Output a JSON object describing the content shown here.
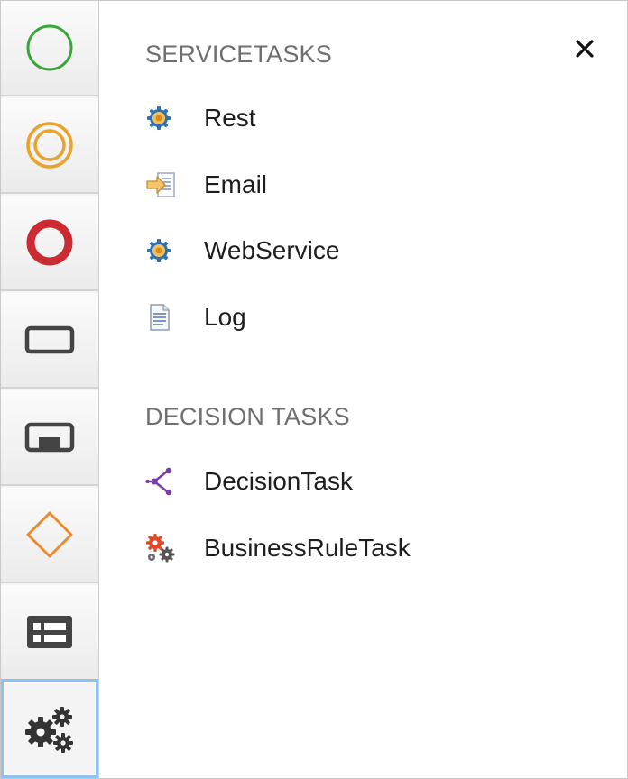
{
  "toolbar": {
    "tools": [
      {
        "icon": "start-event-icon",
        "color": "#3aa63a"
      },
      {
        "icon": "intermediate-event-icon",
        "color": "#e9a22a"
      },
      {
        "icon": "end-event-icon",
        "color": "#cc2b33"
      },
      {
        "icon": "task-icon",
        "color": "#444444"
      },
      {
        "icon": "subprocess-icon",
        "color": "#444444"
      },
      {
        "icon": "gateway-icon",
        "color": "#ee8a2e"
      },
      {
        "icon": "lane-icon",
        "color": "#444444"
      },
      {
        "icon": "gears-icon",
        "color": "#333333",
        "active": true
      }
    ]
  },
  "panel": {
    "close_label": "×",
    "sections": [
      {
        "title": "SERVICETASKS",
        "items": [
          {
            "label": "Rest",
            "icon": "rest-gear-icon"
          },
          {
            "label": "Email",
            "icon": "email-arrow-icon"
          },
          {
            "label": "WebService",
            "icon": "webservice-gear-icon"
          },
          {
            "label": "Log",
            "icon": "log-document-icon"
          }
        ]
      },
      {
        "title": "DECISION TASKS",
        "items": [
          {
            "label": "DecisionTask",
            "icon": "decision-branch-icon"
          },
          {
            "label": "BusinessRuleTask",
            "icon": "business-rule-gears-icon"
          }
        ]
      }
    ]
  }
}
